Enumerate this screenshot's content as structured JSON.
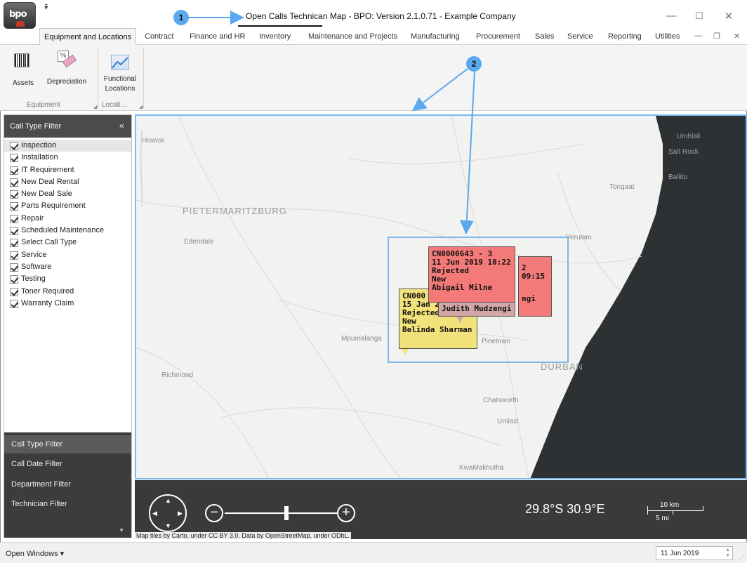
{
  "window": {
    "title": "Open Calls Technican Map - BPO: Version 2.1.0.71 - Example Company",
    "logo_text": "bpo",
    "qat_icon": "dropdown-arrow-icon"
  },
  "callouts": [
    "1",
    "2"
  ],
  "tabs": [
    {
      "label": "Equipment and Locations",
      "active": true
    },
    {
      "label": "Contract"
    },
    {
      "label": "Finance and HR"
    },
    {
      "label": "Inventory"
    },
    {
      "label": "Maintenance and Projects"
    },
    {
      "label": "Manufacturing"
    },
    {
      "label": "Procurement"
    },
    {
      "label": "Sales"
    },
    {
      "label": "Service"
    },
    {
      "label": "Reporting"
    },
    {
      "label": "Utilities"
    }
  ],
  "ribbon": {
    "assets_label": "Assets",
    "depreciation_label": "Depreciation",
    "functional_locations_label_1": "Functional",
    "functional_locations_label_2": "Locations",
    "group_equipment": "Equipment",
    "group_locations": "Locati..."
  },
  "left_panel": {
    "header": "Call Type Filter",
    "collapse_icon": "«",
    "filters": [
      "Inspection",
      "Installation",
      "IT Requirement",
      "New Deal Rental",
      "New Deal Sale",
      "Parts Requirement",
      "Repair",
      "Scheduled Maintenance",
      "Select Call Type",
      "Service",
      "Software",
      "Testing",
      "Toner Required",
      "Warranty Claim"
    ],
    "nav": [
      "Call Type Filter",
      "Call Date Filter",
      "Department Filter",
      "Technician Filter"
    ]
  },
  "map": {
    "places": {
      "howick": "Howick",
      "umhlali": "Umhlali",
      "salt_rock": "Salt Rock",
      "ballito": "Ballito",
      "tongaat": "Tongaat",
      "pietermaritzburg": "PIETERMARITZBURG",
      "edendale": "Edendale",
      "verulam": "Verulam",
      "mpumalanga": "Mpumalanga",
      "pinetown": "Pinetown",
      "durban": "DURBAN",
      "richmond": "Richmond",
      "chatsworth": "Chatsworth",
      "umlazi": "Umlazi",
      "kwamakhutha": "KwaMakhutha"
    },
    "markers": {
      "red_front": [
        "CN0000643 - 3",
        "11 Jun 2019 10:22",
        "Rejected",
        "New",
        "Abigail Milne"
      ],
      "red_back": [
        "2",
        "09:15",
        "ngi"
      ],
      "yellow": [
        "CN000",
        "15 Jan 2",
        "Rejected",
        "New",
        "Belinda Sharman"
      ],
      "pink": [
        "Judith Mudzengi"
      ]
    },
    "coords": "29.8°S  30.9°E",
    "scale_km": "10 km",
    "scale_mi": "5 mi",
    "attribution": "Map tiles by Carto, under CC BY 3.0. Data by OpenStreetMap, under ODbL.",
    "zoom_level": 0.55
  },
  "status": {
    "open_windows": "Open Windows ▾",
    "date": "11 Jun 2019"
  },
  "colors": {
    "marker_red": "#f47a7a",
    "marker_yellow": "#f2e27c",
    "marker_pink": "#d2a6a6",
    "callout_blue": "#5aa9ee",
    "panel_dark": "#3c3c3c"
  }
}
